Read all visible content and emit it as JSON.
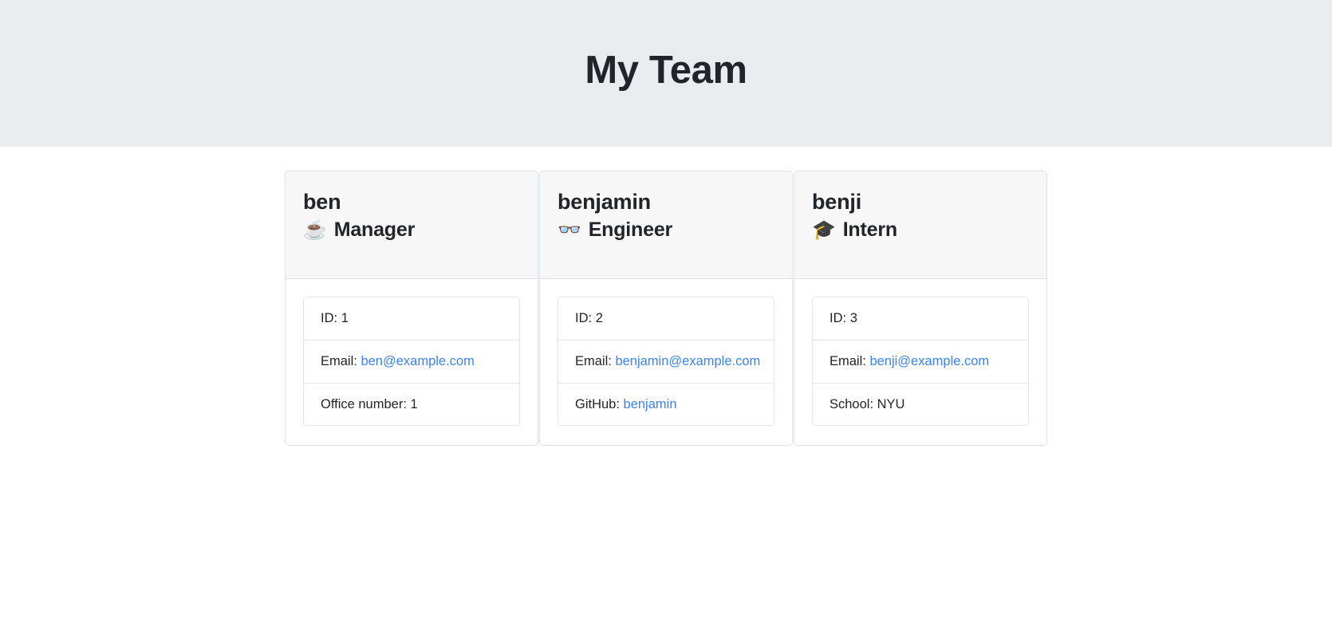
{
  "header": {
    "title": "My Team"
  },
  "team": {
    "members": [
      {
        "name": "ben",
        "role": "Manager",
        "role_icon": "hot-beverage-icon",
        "role_emoji": "☕",
        "fields": [
          {
            "label": "ID:",
            "value": "1",
            "is_link": false
          },
          {
            "label": "Email:",
            "value": "ben@example.com",
            "is_link": true
          },
          {
            "label": "Office number:",
            "value": "1",
            "is_link": false
          }
        ]
      },
      {
        "name": "benjamin",
        "role": "Engineer",
        "role_icon": "glasses-icon",
        "role_emoji": "👓",
        "fields": [
          {
            "label": "ID:",
            "value": "2",
            "is_link": false
          },
          {
            "label": "Email:",
            "value": "benjamin@example.com",
            "is_link": true
          },
          {
            "label": "GitHub:",
            "value": "benjamin",
            "is_link": true
          }
        ]
      },
      {
        "name": "benji",
        "role": "Intern",
        "role_icon": "graduate-icon",
        "role_emoji": "🎓",
        "fields": [
          {
            "label": "ID:",
            "value": "3",
            "is_link": false
          },
          {
            "label": "Email:",
            "value": "benji@example.com",
            "is_link": true
          },
          {
            "label": "School:",
            "value": "NYU",
            "is_link": false
          }
        ]
      }
    ]
  },
  "colors": {
    "band_background": "#e9ecef",
    "card_header_background": "#f7f7f7",
    "link": "#3b82f6",
    "text": "#212529",
    "border": "#dee2e6"
  }
}
